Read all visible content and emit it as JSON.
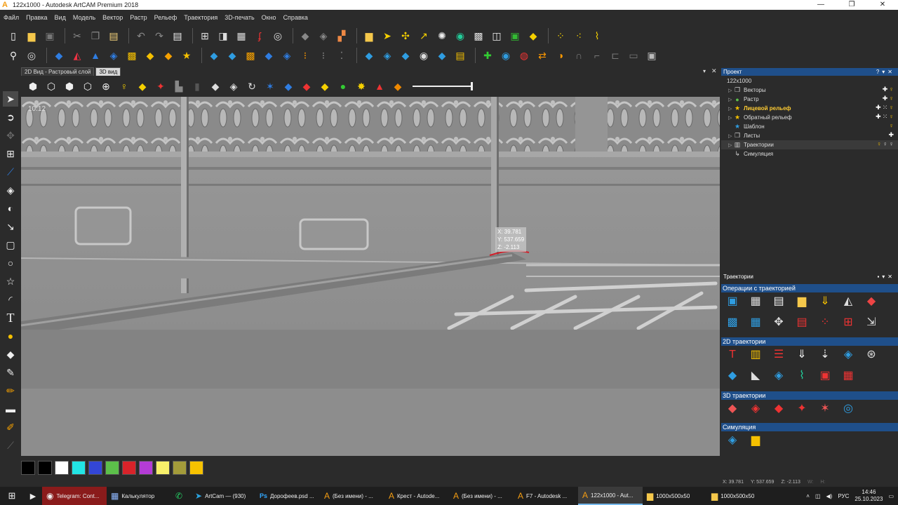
{
  "window": {
    "title": "122x1000 - Autodesk ArtCAM Premium 2018",
    "min": "—",
    "restore": "❐",
    "close": "✕"
  },
  "menu": [
    "Файл",
    "Правка",
    "Вид",
    "Модель",
    "Вектор",
    "Растр",
    "Рельеф",
    "Траектория",
    "3D-печать",
    "Окно",
    "Справка"
  ],
  "doc_tabs": [
    "2D Вид - Растровый слой",
    "3D вид"
  ],
  "viewport": {
    "corner_label": "10.12",
    "coords": {
      "x": "X: 39.781",
      "y": "Y: 537.659",
      "z": "Z: -2.113"
    }
  },
  "project_panel": {
    "title": "Проект",
    "items": [
      {
        "label": "122x1000",
        "icon": "",
        "arrow": ""
      },
      {
        "label": "Векторы",
        "icon": "❐",
        "arrow": "▷"
      },
      {
        "label": "Растр",
        "icon": "●",
        "arrow": "▷"
      },
      {
        "label": "Лицевой рельеф",
        "icon": "★",
        "arrow": "▷"
      },
      {
        "label": "Обратный рельеф",
        "icon": "★",
        "arrow": "▷"
      },
      {
        "label": "Шаблон",
        "icon": "★",
        "arrow": ""
      },
      {
        "label": "Листы",
        "icon": "❐",
        "arrow": "▷"
      },
      {
        "label": "Траектории",
        "icon": "▥",
        "arrow": "▷"
      },
      {
        "label": "Симуляция",
        "icon": "↳",
        "arrow": ""
      }
    ]
  },
  "toolpaths_panel": {
    "title": "Траектории",
    "sections": [
      "Операции с траекторией",
      "2D траектории",
      "3D траектории",
      "Симуляция"
    ]
  },
  "palette_colors": [
    "#000000",
    "#ffffff",
    "#22e4e4",
    "#3346d6",
    "#5cbf4a",
    "#d8232a",
    "#b43cd6",
    "#f7f06a",
    "#a39b3a",
    "#f7c200"
  ],
  "status": {
    "x": "X: 39.781",
    "y": "Y: 537.659",
    "z": "Z: -2.113",
    "w": "W:",
    "h": "H:"
  },
  "taskbar": {
    "items": [
      {
        "label": "Telegram: Cont...",
        "icon": "◉"
      },
      {
        "label": "Калькулятор",
        "icon": "▦"
      },
      {
        "label": "",
        "icon": "✆"
      },
      {
        "label": "ArtCam — (930)",
        "icon": "➤"
      },
      {
        "label": "Дорофеев.psd ...",
        "icon": "Ps"
      },
      {
        "label": "(Без имени) - ...",
        "icon": "A"
      },
      {
        "label": "Крест - Autode...",
        "icon": "A"
      },
      {
        "label": "(Без имени) - ...",
        "icon": "A"
      },
      {
        "label": "F7 - Autodesk ...",
        "icon": "A"
      },
      {
        "label": "122x1000 - Aut...",
        "icon": "A"
      },
      {
        "label": "1000x500x50",
        "icon": "▆"
      },
      {
        "label": "1000x500x50",
        "icon": "▆"
      }
    ],
    "lang": "РУС",
    "time": "14:46",
    "date": "25.10.2023"
  }
}
